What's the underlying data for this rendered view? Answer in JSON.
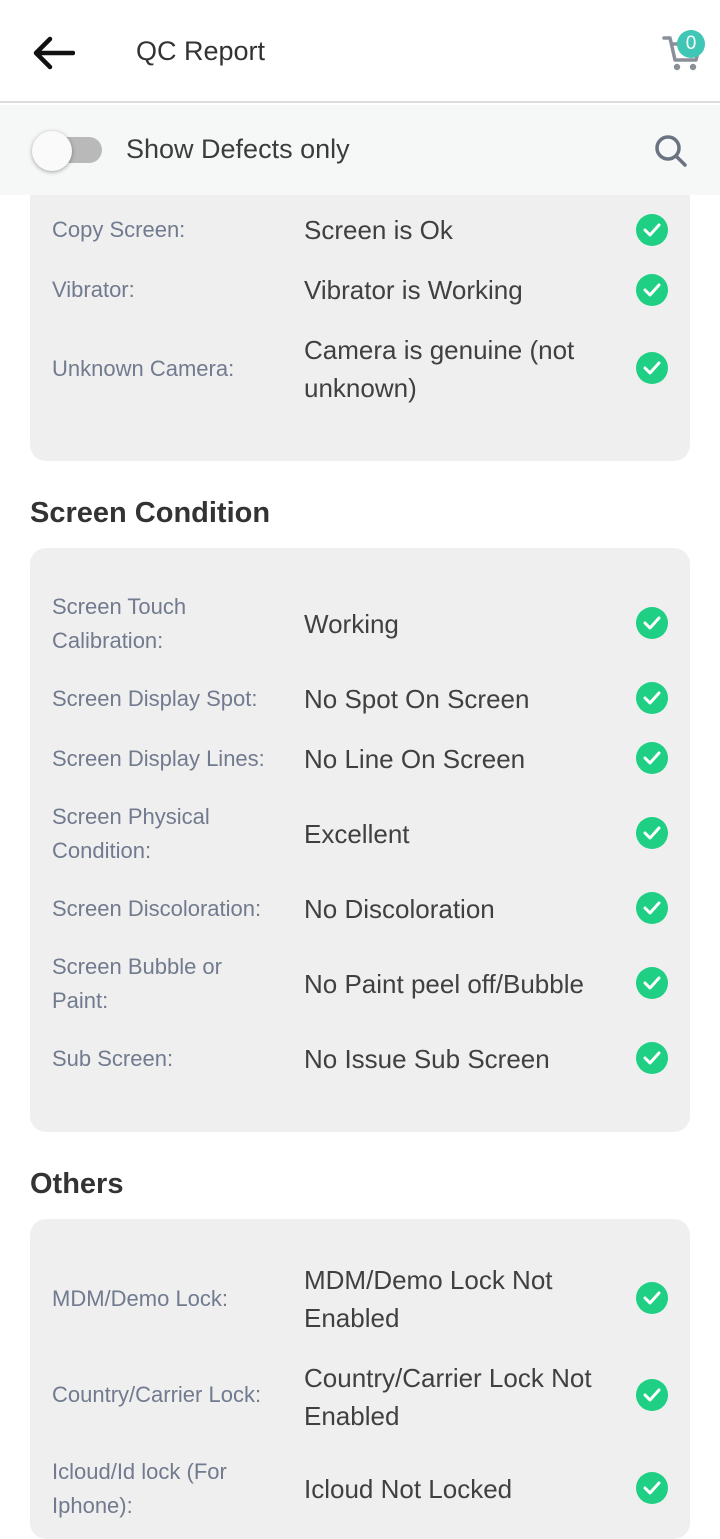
{
  "header": {
    "title": "QC Report",
    "cart_count": "0",
    "icons": [
      "back-arrow-icon",
      "cart-icon"
    ]
  },
  "filter": {
    "toggle_label": "Show Defects only",
    "toggle_on": false,
    "icons": [
      "search-icon"
    ]
  },
  "colors": {
    "accent": "#3fc6b4",
    "pass": "#1ecf84",
    "card_bg": "#efefef",
    "label": "#717a8e"
  },
  "sections": [
    {
      "title": "",
      "rows": [
        {
          "label": "Copy Screen:",
          "value": "Screen is Ok",
          "status": "pass"
        },
        {
          "label": "Vibrator:",
          "value": "Vibrator is Working",
          "status": "pass"
        },
        {
          "label": "Unknown Camera:",
          "value": "Camera is genuine (not unknown)",
          "status": "pass"
        }
      ]
    },
    {
      "title": "Screen Condition",
      "rows": [
        {
          "label": "Screen Touch Calibration:",
          "value": "Working",
          "status": "pass"
        },
        {
          "label": "Screen Display Spot:",
          "value": "No Spot On Screen",
          "status": "pass"
        },
        {
          "label": "Screen Display Lines:",
          "value": "No Line On Screen",
          "status": "pass"
        },
        {
          "label": "Screen Physical Condition:",
          "value": "Excellent",
          "status": "pass"
        },
        {
          "label": "Screen Discoloration:",
          "value": "No Discoloration",
          "status": "pass"
        },
        {
          "label": "Screen Bubble or Paint:",
          "value": "No Paint peel off/Bubble",
          "status": "pass"
        },
        {
          "label": "Sub Screen:",
          "value": "No Issue Sub Screen",
          "status": "pass"
        }
      ]
    },
    {
      "title": "Others",
      "rows": [
        {
          "label": "MDM/Demo Lock:",
          "value": "MDM/Demo Lock Not Enabled",
          "status": "pass"
        },
        {
          "label": "Country/Carrier Lock:",
          "value": "Country/Carrier Lock Not Enabled",
          "status": "pass"
        },
        {
          "label": "Icloud/Id lock (For Iphone):",
          "value": "Icloud Not Locked",
          "status": "pass"
        }
      ]
    }
  ]
}
